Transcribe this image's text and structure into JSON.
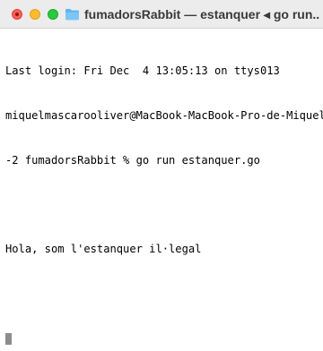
{
  "window": {
    "title": "fumadorsRabbit — estanquer ◂ go run..."
  },
  "terminal": {
    "lines": [
      "Last login: Fri Dec  4 13:05:13 on ttys013",
      "miquelmascarooliver@MacBook-MacBook-Pro-de-Miquel",
      "-2 fumadorsRabbit % go run estanquer.go",
      "",
      "Hola, som l'estanquer il·legal",
      ""
    ]
  },
  "icons": {
    "title_icon": "folder-icon",
    "traffic_lights": [
      "close-icon",
      "minimize-icon",
      "zoom-icon"
    ]
  },
  "colors": {
    "close": "#ff5f57",
    "minimize": "#febc2e",
    "zoom": "#28c840",
    "folder": "#5ab4f2",
    "cursor": "#8c8c8c"
  }
}
